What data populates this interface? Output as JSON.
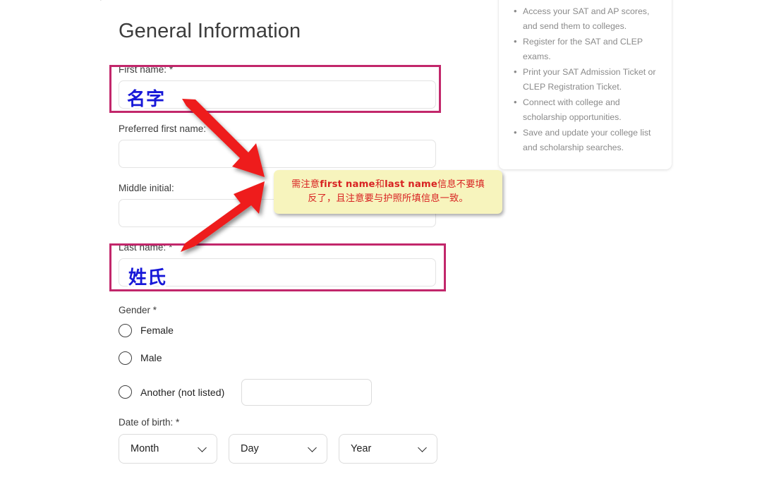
{
  "top_partial_text": "·",
  "page_title": "General Information",
  "form": {
    "first_name": {
      "label": "First name: *",
      "value": "名字",
      "placeholder": ""
    },
    "preferred_first_name": {
      "label": "Preferred first name:",
      "value": "",
      "placeholder": ""
    },
    "middle_initial": {
      "label": "Middle initial:",
      "value": "",
      "placeholder": ""
    },
    "last_name": {
      "label": "Last name: *",
      "value": "姓氏",
      "placeholder": ""
    },
    "gender": {
      "label": "Gender *",
      "options": [
        {
          "label": "Female",
          "selected": false
        },
        {
          "label": "Male",
          "selected": false
        },
        {
          "label": "Another (not listed)",
          "selected": false
        }
      ],
      "another_value": "",
      "another_placeholder": ""
    },
    "date_of_birth": {
      "label": "Date of birth: *",
      "selects": [
        {
          "name": "month",
          "value": "Month"
        },
        {
          "name": "day",
          "value": "Day"
        },
        {
          "name": "year",
          "value": "Year"
        }
      ]
    }
  },
  "sidebar": {
    "items": [
      "Access your SAT and AP scores, and send them to colleges.",
      "Register for the SAT and CLEP exams.",
      "Print your SAT Admission Ticket or CLEP Registration Ticket.",
      "Connect with college and scholarship opportunities.",
      "Save and update your college list and scholarship searches."
    ]
  },
  "annotations": {
    "note_line1_pre": "需注意",
    "note_line1_b1": "first name",
    "note_line1_mid": "和",
    "note_line1_b2": "last name",
    "note_line1_post": "信息不要填",
    "note_line2": "反了，且注意要与护照所填信息一致。"
  },
  "colors": {
    "highlight_border": "#c2276b",
    "arrow": "#ee1c1c",
    "note_bg": "#f7f4bd",
    "note_text": "#d82222",
    "value_text": "#1718d8"
  }
}
